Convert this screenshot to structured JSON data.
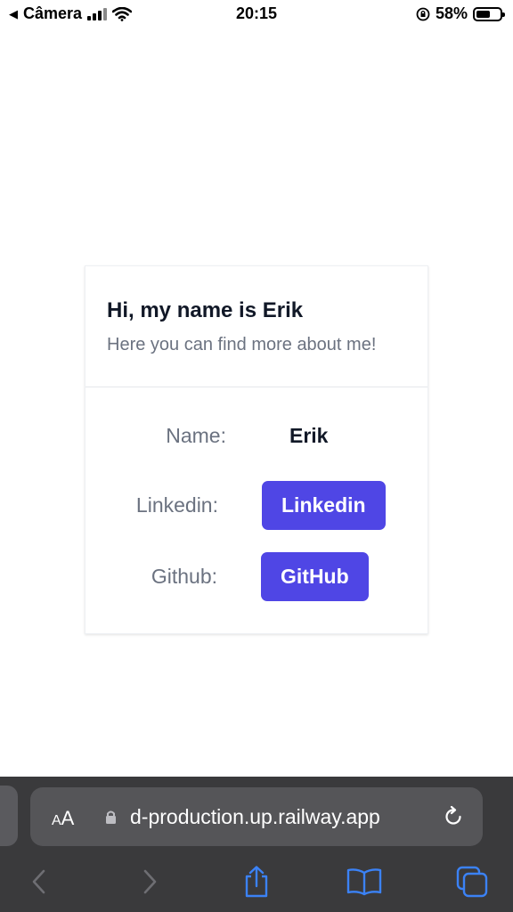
{
  "status_bar": {
    "back_app": "Câmera",
    "time": "20:15",
    "battery_percent": "58%",
    "battery_level": 0.58
  },
  "card": {
    "title": "Hi, my name is Erik",
    "subtitle": "Here you can find more about me!",
    "rows": [
      {
        "label": "Name:",
        "value": "Erik"
      },
      {
        "label": "Linkedin:",
        "button": "Linkedin"
      },
      {
        "label": "Github:",
        "button": "GitHub"
      }
    ]
  },
  "browser": {
    "text_size_label": "AA",
    "url": "d-production.up.railway.app",
    "icons": [
      "lock-icon",
      "reload-icon",
      "back-arrow-icon",
      "forward-arrow-icon",
      "share-icon",
      "bookmarks-icon",
      "tabs-icon"
    ]
  },
  "colors": {
    "accent": "#4f46e5",
    "muted_text": "#6b7280",
    "heading_text": "#111827",
    "toolbar_bg": "#3a3a3c",
    "toolbar_icon": "#3b82f6"
  }
}
